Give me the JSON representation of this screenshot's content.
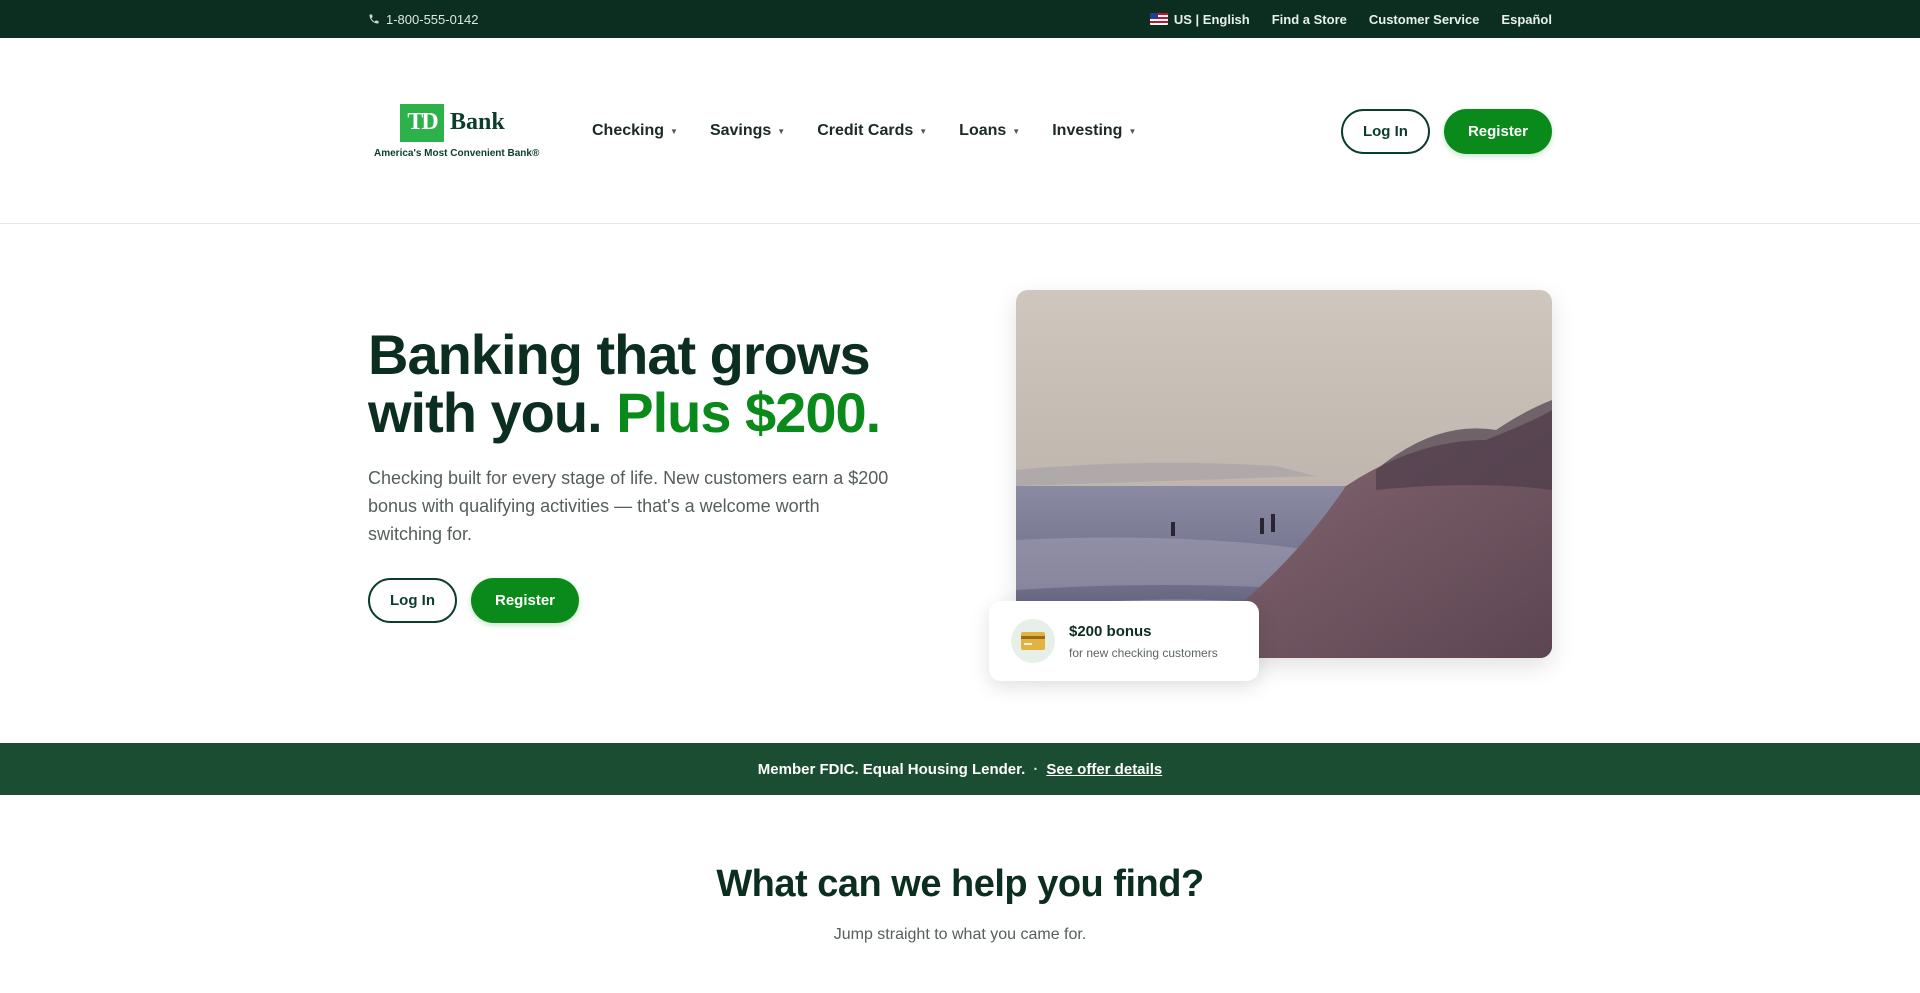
{
  "topbar": {
    "phone": "1-800-555-0142",
    "locale": "US | English",
    "links": [
      "Find a Store",
      "Customer Service",
      "Español"
    ]
  },
  "header": {
    "logo_mark": "TD",
    "logo_bank": "Bank",
    "logo_tagline": "America's Most Convenient Bank®",
    "nav": [
      "Checking",
      "Savings",
      "Credit Cards",
      "Loans",
      "Investing"
    ],
    "login_label": "Log In",
    "register_label": "Register"
  },
  "hero": {
    "title_line1": "Banking that grows",
    "title_line2": "with you.",
    "title_accent": "Plus $200.",
    "subtitle": "Checking built for every stage of life. New customers earn a $200 bonus with qualifying activities — that's a welcome worth switching for.",
    "login_label": "Log In",
    "register_label": "Register",
    "bonus_title": "$200 bonus",
    "bonus_sub": "for new checking customers",
    "bonus_icon": "credit-card-icon"
  },
  "strip": {
    "text": "Member FDIC. Equal Housing Lender.",
    "separator": "·",
    "link": "See offer details"
  },
  "help": {
    "title": "What can we help you find?",
    "subtitle": "Jump straight to what you came for."
  },
  "colors": {
    "brand_green": "#0a8a1a",
    "dark_green": "#0b2e20",
    "strip_green": "#1b4d33"
  }
}
